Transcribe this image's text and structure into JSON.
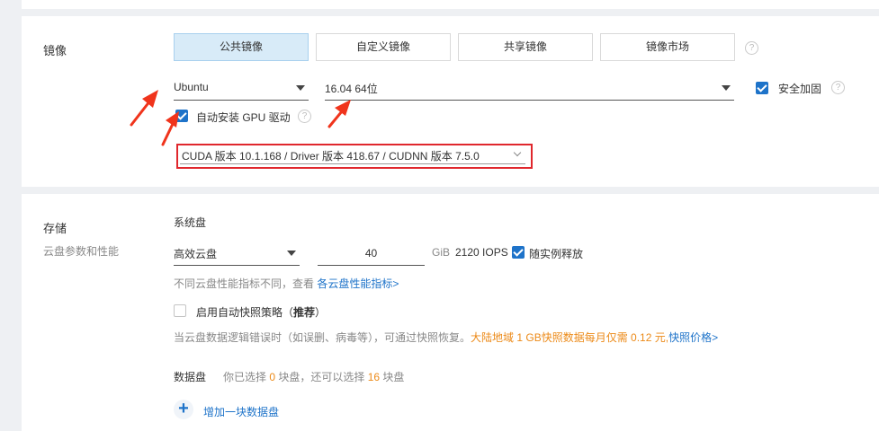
{
  "image_section": {
    "title": "镜像",
    "tabs": [
      {
        "label": "公共镜像",
        "active": true
      },
      {
        "label": "自定义镜像",
        "active": false
      },
      {
        "label": "共享镜像",
        "active": false
      },
      {
        "label": "镜像市场",
        "active": false
      }
    ],
    "help_glyph": "?",
    "os_select": {
      "value": "Ubuntu"
    },
    "version_select": {
      "value": "16.04 64位"
    },
    "security_hardening": {
      "label": "安全加固",
      "checked": true
    },
    "auto_gpu_driver": {
      "label": "自动安装 GPU 驱动",
      "checked": true
    },
    "cuda_select": {
      "value": "CUDA 版本 10.1.168 / Driver 版本 418.67 / CUDNN 版本 7.5.0"
    }
  },
  "storage_section": {
    "title": "存储",
    "subtitle": "云盘参数和性能",
    "system_disk": {
      "label": "系统盘",
      "type": "高效云盘",
      "size": "40",
      "unit": "GiB",
      "iops": "2120 IOPS",
      "release_with_instance": {
        "label": "随实例释放",
        "checked": true
      }
    },
    "perf_note": {
      "text": "不同云盘性能指标不同，查看 ",
      "link": "各云盘性能指标>"
    },
    "snapshot_policy": {
      "label": "启用自动快照策略（",
      "bold": "推荐",
      "label_end": "）",
      "checked": false
    },
    "snapshot_note": {
      "text": "当云盘数据逻辑错误时（如误删、病毒等），可通过快照恢复。",
      "price_text": "大陆地域 1 GB快照数据每月仅需 0.12 元,",
      "link": "快照价格>"
    },
    "data_disk": {
      "label": "数据盘",
      "selected_prefix": "你已选择 ",
      "selected_count": "0",
      "selected_mid": " 块盘，还可以选择 ",
      "remaining_count": "16",
      "selected_suffix": " 块盘"
    },
    "add_data_disk": {
      "icon": "+",
      "label": "增加一块数据盘"
    }
  },
  "colors": {
    "accent": "#1e73c9",
    "highlight_box": "#e0272d",
    "annotation_arrow": "#f0341c",
    "price_orange": "#ec8a18"
  }
}
